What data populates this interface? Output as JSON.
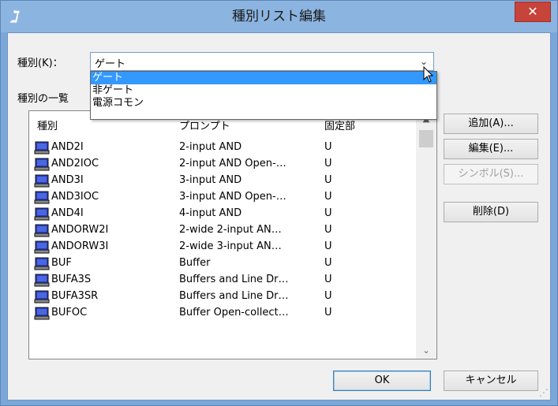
{
  "window": {
    "title": "種別リスト編集",
    "close_glyph": "✕"
  },
  "type_field": {
    "label": "種別(K)：",
    "value": "ゲート",
    "dropdown_options": [
      "ゲート",
      "非ゲート",
      "電源コモン"
    ],
    "selected_index": 0
  },
  "list": {
    "label": "種別の一覧",
    "columns": [
      "種別",
      "プロンプト",
      "固定部"
    ],
    "rows": [
      {
        "name": "AND2I",
        "prompt": "2-input AND",
        "fixed": "U"
      },
      {
        "name": "AND2IOC",
        "prompt": "2-input AND Open-…",
        "fixed": "U"
      },
      {
        "name": "AND3I",
        "prompt": "3-input AND",
        "fixed": "U"
      },
      {
        "name": "AND3IOC",
        "prompt": "3-input AND Open-…",
        "fixed": "U"
      },
      {
        "name": "AND4I",
        "prompt": "4-input AND",
        "fixed": "U"
      },
      {
        "name": "ANDORW2I",
        "prompt": "2-wide 2-input AN…",
        "fixed": "U"
      },
      {
        "name": "ANDORW3I",
        "prompt": "2-wide 3-input AN…",
        "fixed": "U"
      },
      {
        "name": "BUF",
        "prompt": "Buffer",
        "fixed": "U"
      },
      {
        "name": "BUFA3S",
        "prompt": "Buffers and Line Dr…",
        "fixed": "U"
      },
      {
        "name": "BUFA3SR",
        "prompt": "Buffers and Line Dr…",
        "fixed": "U"
      },
      {
        "name": "BUFOC",
        "prompt": "Buffer Open-collect…",
        "fixed": "U"
      }
    ]
  },
  "buttons": {
    "add": "追加(A)...",
    "edit": "編集(E)...",
    "symbol": "シンボル(S)...",
    "delete": "削除(D)",
    "ok": "OK",
    "cancel": "キャンセル"
  },
  "colors": {
    "title_bar": "#8cb4e0",
    "close_button": "#c7443a",
    "selection": "#3399ff"
  }
}
